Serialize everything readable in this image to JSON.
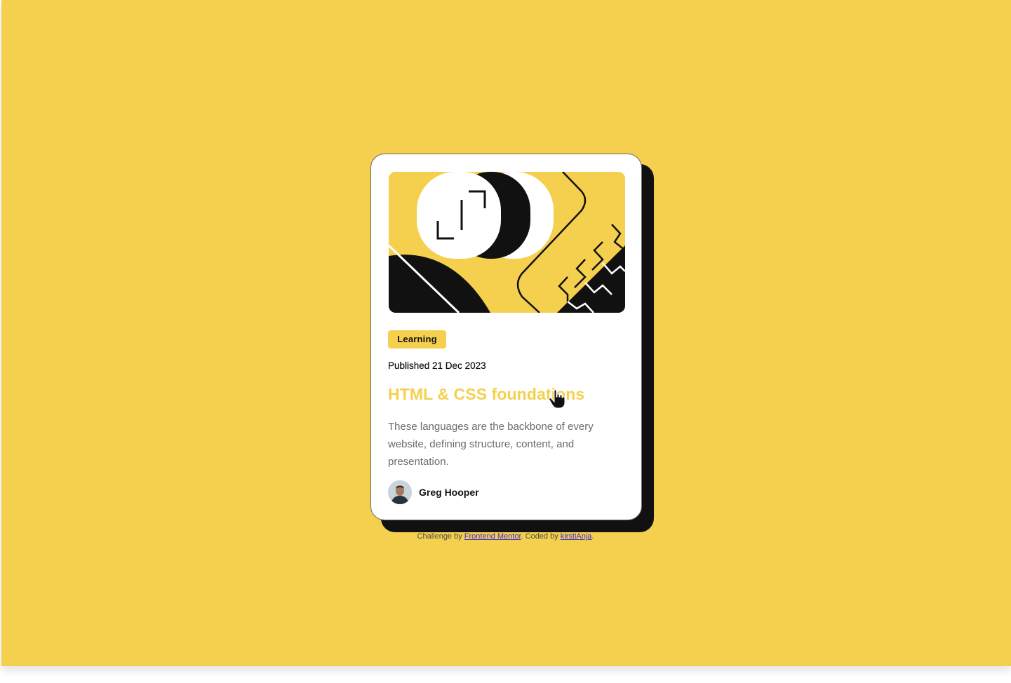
{
  "card": {
    "tag": "Learning",
    "published": "Published 21 Dec 2023",
    "title": "HTML & CSS foundations",
    "description": "These languages are the backbone of every website, defining structure, content, and presentation.",
    "author": {
      "name": "Greg Hooper"
    }
  },
  "attribution": {
    "prefix": "Challenge by ",
    "link1": "Frontend Mentor",
    "middle": ". Coded by ",
    "link2": "kirstiAnja",
    "suffix": "."
  },
  "colors": {
    "background": "#f4d04e",
    "card": "#ffffff",
    "text": "#111111",
    "muted": "#6b6b6b"
  },
  "icons": {
    "illustration": "abstract-shapes-illustration",
    "avatar": "author-avatar",
    "cursor": "hand-pointer-icon"
  }
}
